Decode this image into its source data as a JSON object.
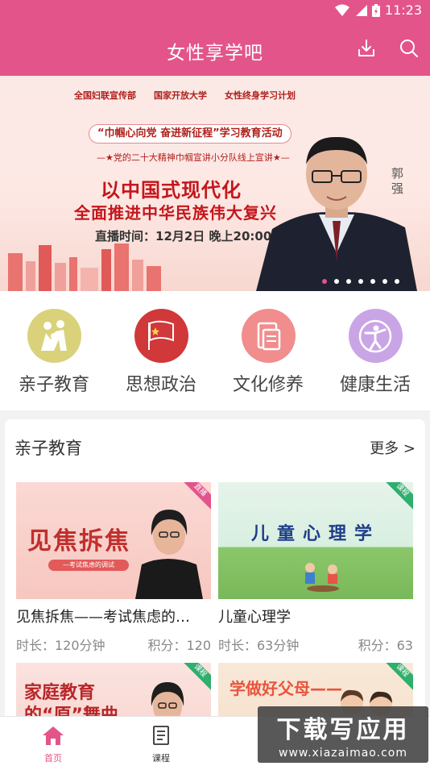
{
  "statusbar": {
    "time": "11:23"
  },
  "header": {
    "title": "女性享学吧",
    "download_icon": "download-icon",
    "search_icon": "search-icon"
  },
  "banner": {
    "logos": [
      "全国妇联宣传部",
      "国家开放大学",
      "女性终身学习计划"
    ],
    "ribbon": "“巾帼心向党 奋进新征程”学习教育活动",
    "sub": "—★党的二十大精神巾帼宣讲小分队线上宣讲★—",
    "headline1": "以中国式现代化",
    "headline2": "全面推进中华民族伟大复兴",
    "time": "直播时间：12月2日 晚上20:00",
    "speaker": "郭强",
    "slides": 7,
    "active_slide": 0
  },
  "categories": [
    {
      "label": "亲子教育",
      "icon": "family-icon",
      "color": "#d9d27a"
    },
    {
      "label": "思想政治",
      "icon": "flag-icon",
      "color": "#d0383a"
    },
    {
      "label": "文化修养",
      "icon": "book-icon",
      "color": "#f18d8d"
    },
    {
      "label": "健康生活",
      "icon": "fitness-icon",
      "color": "#c9a5e6"
    }
  ],
  "section": {
    "title": "亲子教育",
    "more": "更多 >",
    "courses": [
      {
        "title": "见焦拆焦——考试焦虑的…",
        "duration": "时长：120分钟",
        "points": "积分：120",
        "tag": "直播",
        "thumb_text": "见焦拆焦",
        "thumb_sub": "—考试焦虑的调试"
      },
      {
        "title": "儿童心理学",
        "duration": "时长：63分钟",
        "points": "积分：63",
        "tag": "课程",
        "thumb_text": "儿童心理学"
      },
      {
        "tag": "课程",
        "thumb_text": "家庭教育的“原”舞曲"
      },
      {
        "tag": "课程",
        "thumb_text": "学做好父母——"
      }
    ]
  },
  "bottomnav": [
    {
      "label": "首页",
      "icon": "home-icon",
      "active": true
    },
    {
      "label": "课程",
      "icon": "course-list-icon",
      "active": false
    }
  ],
  "watermark": {
    "line1": "下载写应用",
    "line2": "www.xiazaimao.com"
  },
  "colors": {
    "accent": "#e3548a",
    "tag_pink": "#e3548a",
    "tag_green": "#2fae6c"
  }
}
